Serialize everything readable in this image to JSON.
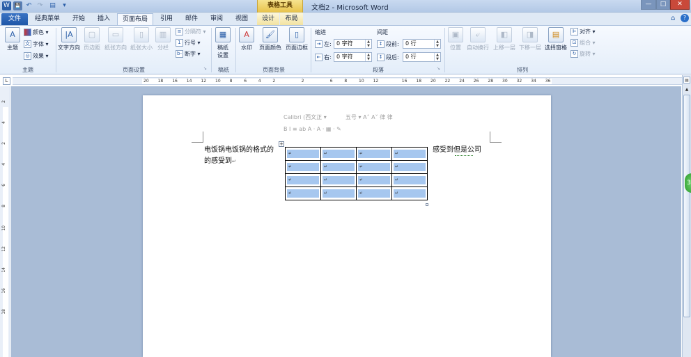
{
  "titlebar": {
    "context_tab": "表格工具",
    "doc_title": "文档2 - Microsoft Word",
    "quick_access": [
      "W",
      "💾",
      "↶",
      "↷",
      "▤",
      "▾"
    ],
    "min": "—",
    "max": "□",
    "close": "✕"
  },
  "tabs": {
    "file": "文件",
    "items": [
      "经典菜单",
      "开始",
      "插入",
      "页面布局",
      "引用",
      "邮件",
      "审阅",
      "视图",
      "设计",
      "布局"
    ],
    "active": "页面布局",
    "help_icons": [
      "⌂",
      "?"
    ]
  },
  "ribbon": {
    "groups": {
      "theme": "主题",
      "page_setup": "页面设置",
      "draft": "稿纸",
      "page_bg": "页面背景",
      "paragraph": "段落",
      "arrange": "排列"
    },
    "theme": {
      "themes": "主题",
      "colors": "颜色",
      "fonts": "字体",
      "effects": "效果"
    },
    "page_setup": {
      "text_dir": "文字方向",
      "margins": "页边距",
      "orientation": "纸张方向",
      "size": "纸张大小",
      "columns": "分栏",
      "breaks": "分隔符",
      "line_numbers": "行号",
      "hyphenation": "断字"
    },
    "draft": {
      "draft_setup": "稿纸\n设置"
    },
    "page_bg": {
      "watermark": "水印",
      "page_color": "页面颜色",
      "page_border": "页面边框"
    },
    "paragraph": {
      "indent_label": "缩进",
      "spacing_label": "间距",
      "left_label": "左:",
      "right_label": "右:",
      "before_label": "段前:",
      "after_label": "段后:",
      "left_val": "0 字符",
      "right_val": "0 字符",
      "before_val": "0 行",
      "after_val": "0 行"
    },
    "arrange": {
      "position": "位置",
      "wrap": "自动换行",
      "bring_forward": "上移一层",
      "send_backward": "下移一层",
      "selection_pane": "选择窗格",
      "align": "对齐",
      "group": "组合",
      "rotate": "旋转"
    }
  },
  "ruler": {
    "h_ticks": [
      "20",
      "18",
      "16",
      "14",
      "12",
      "10",
      "8",
      "6",
      "4",
      "2",
      "",
      "2",
      "",
      "6",
      "8",
      "10",
      "12",
      "",
      "16",
      "18",
      "20",
      "22",
      "24",
      "26",
      "28",
      "30",
      "32",
      "34",
      "36"
    ],
    "v_ticks": [
      "2",
      "4",
      "2",
      "4",
      "6",
      "8",
      "10",
      "12",
      "14",
      "16",
      "18"
    ]
  },
  "document": {
    "text_line1": "电饭锅电饭锅的格式的",
    "text_line2": "的感受到",
    "text_right": "感受到但是公司",
    "para_mark": "↵",
    "table_rows": 4,
    "table_cols": 4,
    "cell_mark": "↵"
  },
  "mini_toolbar": {
    "font": "Calibri (西文正",
    "size": "五号",
    "row2": "B  I  ≡  ab  A  ·  A  ·  ▦  ·  ✎"
  },
  "side_badge": "3"
}
